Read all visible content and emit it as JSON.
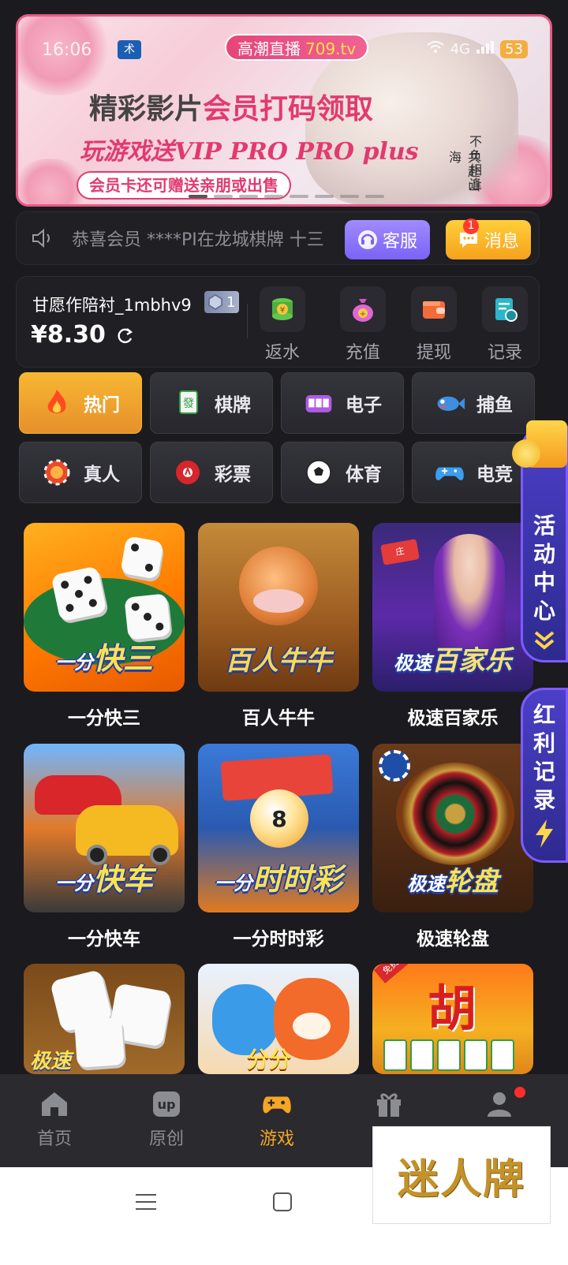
{
  "status_bar": {
    "time": "16:06",
    "app_badge": "术",
    "network": "4G",
    "battery": "53"
  },
  "banner": {
    "live_label": "高潮直播",
    "live_url": "709.tv",
    "line1_a": "精彩影片",
    "line1_b": "会员打码领取",
    "line2": "玩游戏送VIP PRO PRO plus",
    "line3": "会员卡还可赠送亲朋或出售",
    "vertical_1": "不负相逢",
    "vertical_2": "共赴山海"
  },
  "notice": {
    "text": "恭喜会员 ****PI在龙城棋牌 十三",
    "service_label": "客服",
    "message_label": "消息",
    "message_badge": "1"
  },
  "account": {
    "username": "甘愿作陪衬_1mbhv9",
    "vip_level": "1",
    "balance": "¥8.30",
    "actions": [
      {
        "label": "返水",
        "icon": "coins-icon"
      },
      {
        "label": "充值",
        "icon": "money-bag-icon"
      },
      {
        "label": "提现",
        "icon": "wallet-icon"
      },
      {
        "label": "记录",
        "icon": "record-icon"
      }
    ]
  },
  "categories": [
    {
      "label": "热门",
      "icon": "fire-icon"
    },
    {
      "label": "棋牌",
      "icon": "mahjong-icon"
    },
    {
      "label": "电子",
      "icon": "slot-icon"
    },
    {
      "label": "捕鱼",
      "icon": "fish-icon"
    },
    {
      "label": "真人",
      "icon": "chip-icon"
    },
    {
      "label": "彩票",
      "icon": "lottery-ball-icon"
    },
    {
      "label": "体育",
      "icon": "soccer-icon"
    },
    {
      "label": "电竞",
      "icon": "gamepad-icon"
    }
  ],
  "games": [
    {
      "name": "一分快三",
      "art_prefix": "一分",
      "art_title": "快三"
    },
    {
      "name": "百人牛牛",
      "art_prefix": "",
      "art_title": "百人牛牛"
    },
    {
      "name": "极速百家乐",
      "art_prefix": "极速",
      "art_title": "百家乐"
    },
    {
      "name": "一分快车",
      "art_prefix": "一分",
      "art_title": "快车"
    },
    {
      "name": "一分时时彩",
      "art_prefix": "一分",
      "art_title": "时时彩"
    },
    {
      "name": "极速轮盘",
      "art_prefix": "极速",
      "art_title": "轮盘"
    },
    {
      "name": "",
      "art_prefix": "",
      "art_title": "极速"
    },
    {
      "name": "",
      "art_prefix": "",
      "art_title": "分分"
    },
    {
      "name": "",
      "art_prefix": "免费旋转",
      "art_title": "胡"
    }
  ],
  "side_buttons": {
    "activity": "活动中心",
    "bonus": "红利记录"
  },
  "bottom_nav": [
    {
      "label": "首页",
      "icon": "home-icon"
    },
    {
      "label": "原创",
      "icon": "up-icon"
    },
    {
      "label": "游戏",
      "icon": "gamepad-icon"
    },
    {
      "label": "",
      "icon": "gift-icon"
    },
    {
      "label": "",
      "icon": "profile-icon"
    }
  ],
  "watermark": "迷人牌",
  "colors": {
    "accent": "#f5a623",
    "service": "#7b63f5",
    "message": "#f6a21c",
    "banner_pink": "#e23a6f"
  }
}
